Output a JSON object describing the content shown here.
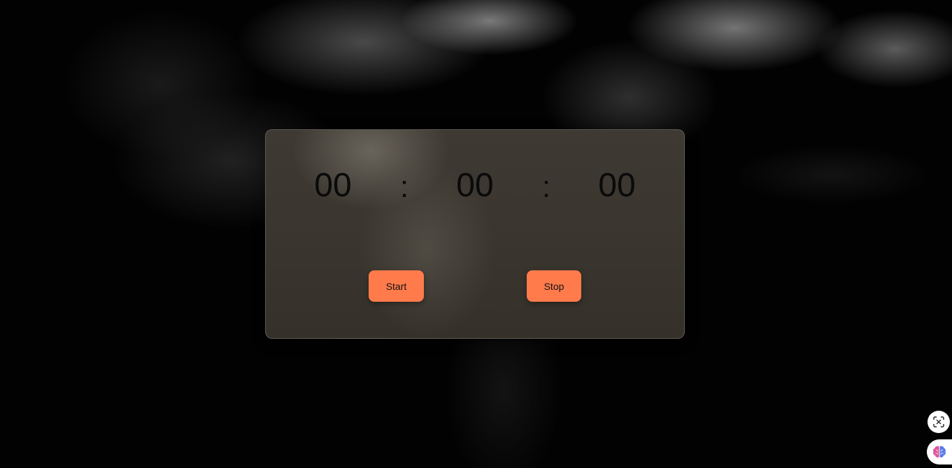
{
  "timer": {
    "hours": "00",
    "minutes": "00",
    "seconds": "00",
    "separator": ":"
  },
  "buttons": {
    "start_label": "Start",
    "stop_label": "Stop"
  },
  "colors": {
    "button_accent": "#ff7b4c",
    "panel": "#3c3831",
    "background": "#000000"
  },
  "floating_icons": [
    "capture-icon",
    "brain-icon"
  ]
}
